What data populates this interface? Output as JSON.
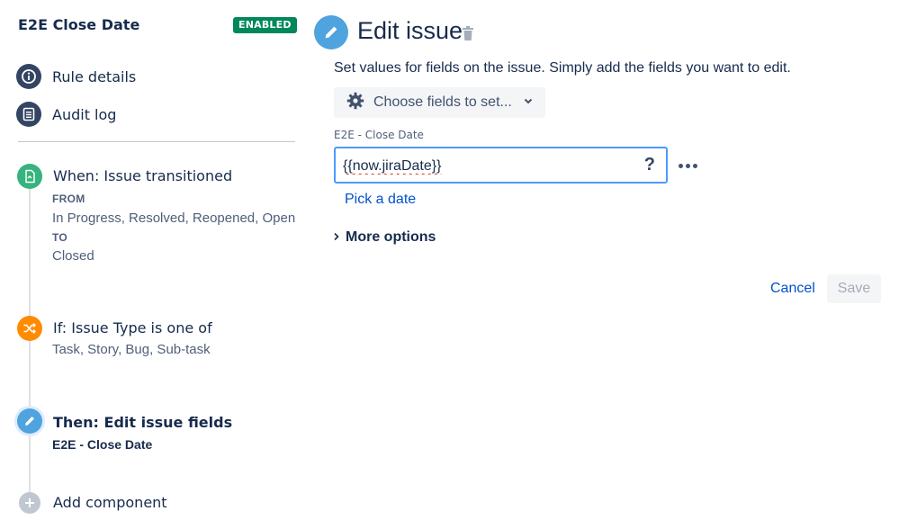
{
  "rule": {
    "title": "E2E Close Date",
    "status_badge": "ENABLED"
  },
  "sidebar": {
    "links": [
      {
        "label": "Rule details",
        "icon": "info-icon"
      },
      {
        "label": "Audit log",
        "icon": "list-icon"
      }
    ],
    "steps": {
      "trigger": {
        "title": "When: Issue transitioned",
        "from_label": "FROM",
        "from_value": "In Progress, Resolved, Reopened, Open",
        "to_label": "TO",
        "to_value": "Closed",
        "icon": "transition-icon",
        "color": "#36b37e"
      },
      "condition": {
        "title": "If: Issue Type is one of",
        "value": "Task, Story, Bug, Sub-task",
        "icon": "shuffle-icon",
        "color": "#ff8b00"
      },
      "action": {
        "title": "Then: Edit issue fields",
        "value": "E2E - Close Date",
        "icon": "pencil-icon",
        "color": "#4fa3de"
      },
      "add": {
        "label": "Add component",
        "icon": "plus-icon",
        "color": "#c1c7d0"
      }
    }
  },
  "main": {
    "title": "Edit issue",
    "description": "Set values for fields on the issue. Simply add the fields you want to edit.",
    "choose_fields_label": "Choose fields to set...",
    "field": {
      "label": "E2E - Close Date",
      "value": "{{now.jiraDate}}",
      "help": "?"
    },
    "pick_date_label": "Pick a date",
    "more_options_label": "More options",
    "cancel_label": "Cancel",
    "save_label": "Save"
  },
  "colors": {
    "accent": "#0052cc",
    "badge": "#00875a",
    "focus": "#4c9aff"
  }
}
